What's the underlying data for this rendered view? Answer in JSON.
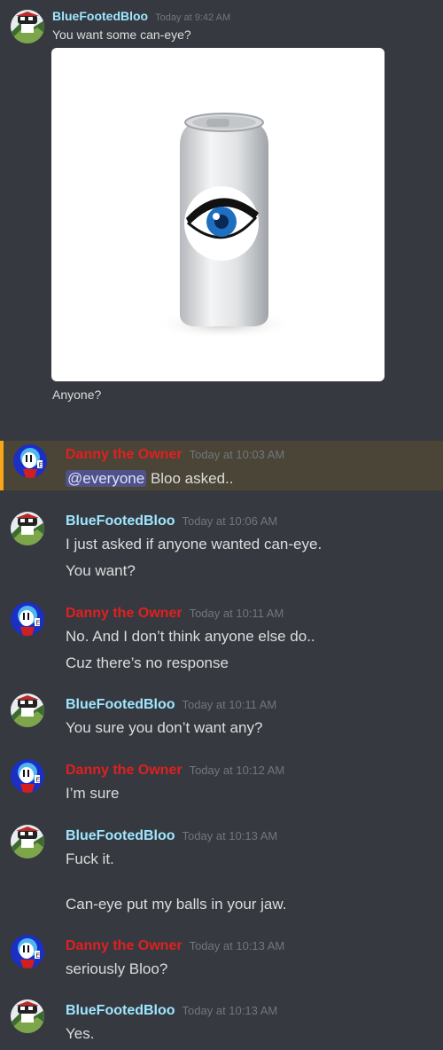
{
  "users": {
    "bloo": "BlueFootedBloo",
    "danny": "Danny the Owner"
  },
  "messages": [
    {
      "author": "BlueFootedBloo",
      "time": "Today at 9:42 AM",
      "lines": [
        "You want some can-eye?",
        "Anyone?"
      ],
      "image": "soda-can-with-eye"
    },
    {
      "author": "Danny the Owner",
      "time": "Today at 10:03 AM",
      "mention": "@everyone",
      "lines": [
        "Bloo asked.."
      ],
      "highlighted": true
    },
    {
      "author": "BlueFootedBloo",
      "time": "Today at 10:06 AM",
      "lines": [
        "I just asked if anyone wanted can-eye.",
        "You want?"
      ]
    },
    {
      "author": "Danny the Owner",
      "time": "Today at 10:11 AM",
      "lines": [
        "No. And I don’t think anyone else do..",
        "Cuz there’s no response"
      ]
    },
    {
      "author": "BlueFootedBloo",
      "time": "Today at 10:11 AM",
      "lines": [
        "You sure you don’t want any?"
      ]
    },
    {
      "author": "Danny the Owner",
      "time": "Today at 10:12 AM",
      "lines": [
        "I’m sure"
      ]
    },
    {
      "author": "BlueFootedBloo",
      "time": "Today at 10:13 AM",
      "lines": [
        "Fuck it.",
        "Can-eye put my balls in your jaw."
      ]
    },
    {
      "author": "Danny the Owner",
      "time": "Today at 10:13 AM",
      "lines": [
        "seriously Bloo?"
      ]
    },
    {
      "author": "BlueFootedBloo",
      "time": "Today at 10:13 AM",
      "lines": [
        "Yes."
      ]
    }
  ],
  "colors": {
    "background": "#36393f",
    "bloo_name": "#9fe6ff",
    "danny_name": "#e02020",
    "timestamp": "#72767d",
    "mention_bg": "#4e5288",
    "highlight_bar": "#faa61a"
  }
}
